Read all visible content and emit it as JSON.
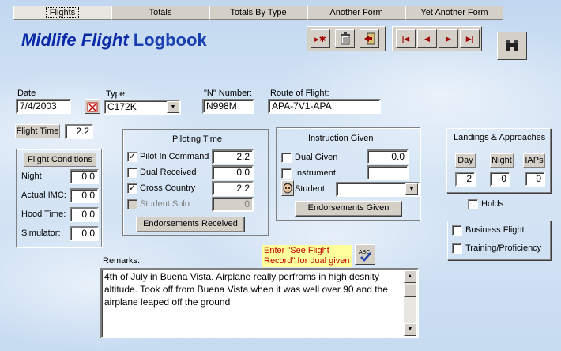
{
  "tabs": [
    "Flights",
    "Totals",
    "Totals By Type",
    "Another Form",
    "Yet Another Form"
  ],
  "title": {
    "part1": "Midlife Flight",
    "part2": "Logbook"
  },
  "toolbar": {
    "new_record_glyph": "▸✱",
    "nav_glyphs": [
      "|◀",
      "◀",
      "▶",
      "▶|"
    ]
  },
  "fields": {
    "date_label": "Date",
    "date_value": "7/4/2003",
    "type_label": "Type",
    "type_value": "C172K",
    "n_number_label": "\"N\" Number:",
    "n_number_value": "N998M",
    "route_label": "Route of Flight:",
    "route_value": "APA-7V1-APA",
    "flight_time_label": "Flight Time",
    "flight_time_value": "2.2"
  },
  "flight_conditions": {
    "title": "Flight Conditions",
    "rows": [
      {
        "label": "Night",
        "value": "0.0"
      },
      {
        "label": "Actual IMC:",
        "value": "0.0"
      },
      {
        "label": "Hood Time:",
        "value": "0.0"
      },
      {
        "label": "Simulator:",
        "value": "0.0"
      }
    ]
  },
  "piloting_time": {
    "title": "Piloting Time",
    "rows": [
      {
        "label": "Pilot In Command",
        "checked": "✓",
        "value": "2.2"
      },
      {
        "label": "Dual Received",
        "checked": "",
        "value": "0.0"
      },
      {
        "label": "Cross Country",
        "checked": "✓",
        "value": "2.2"
      },
      {
        "label": "Student Solo",
        "checked": "",
        "value": "0"
      }
    ],
    "button": "Endorsements Received"
  },
  "instruction_given": {
    "title": "Instruction Given",
    "dual_given_label": "Dual Given",
    "dual_given_value": "0.0",
    "instrument_label": "Instrument",
    "instrument_value": "",
    "student_label": "Student",
    "student_value": "",
    "button": "Endorsements Given"
  },
  "landings": {
    "title": "Landings & Approaches",
    "cols": [
      {
        "label": "Day",
        "value": "2"
      },
      {
        "label": "Night",
        "value": "0"
      },
      {
        "label": "IAPs",
        "value": "0"
      }
    ],
    "holds_label": "Holds"
  },
  "flight_purpose": {
    "business_label": "Business Flight",
    "training_label": "Training/Proficiency"
  },
  "remarks": {
    "label": "Remarks:",
    "note": [
      "Enter \"See Flight",
      "Record\" for dual given"
    ],
    "spell_label": "ABC",
    "text": "4th of July in Buena Vista. Airplane really perfroms in high desnity altitude. Took off from Buena Vista when it was well over 90 and the airplane leaped off the ground"
  }
}
